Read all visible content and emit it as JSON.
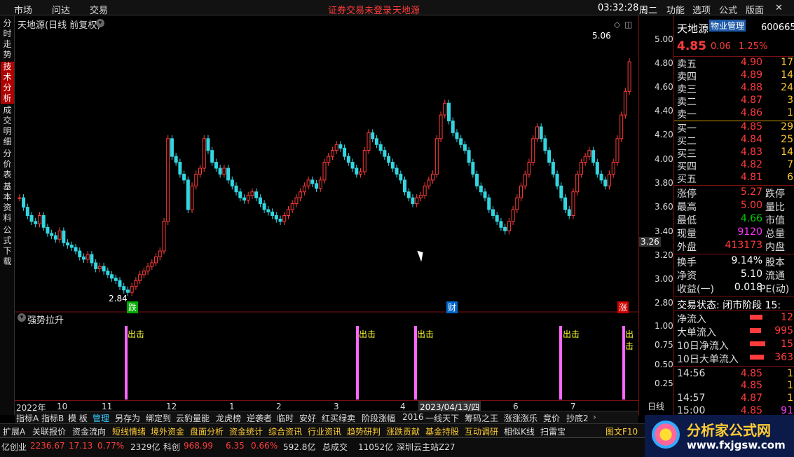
{
  "menubar": {
    "items": [
      "市场",
      "问达",
      "交易"
    ],
    "center_text": "证券交易未登录",
    "center_title": "天地源",
    "time": "03:32:28",
    "weekday": "周二",
    "right_items": [
      "功能",
      "选项",
      "公式",
      "版面"
    ]
  },
  "side_tabs": [
    "分时走势",
    "技术分析",
    "成交明细",
    "分价表",
    "基本资料",
    "公式下载"
  ],
  "chart": {
    "title": "天地源(日线 前复权)",
    "high_label": "5.06",
    "low_label": "2.84",
    "current_price_tag": "3.26",
    "markers": [
      "跌",
      "财",
      "涨"
    ],
    "y_ticks": [
      "5.00",
      "4.80",
      "4.60",
      "4.40",
      "4.20",
      "4.00",
      "3.80",
      "3.60",
      "3.40",
      "3.20",
      "3.00",
      "2.80"
    ],
    "indicator_title": "强势拉升",
    "indicator_y_ticks": [
      "1.00",
      "0.75",
      "0.50",
      "0.25"
    ],
    "signal_label": "出击",
    "x_axis_labels": [
      "2022年",
      "10",
      "11",
      "12",
      "1",
      "2",
      "3",
      "4",
      "2023/04/13/四",
      "6",
      "7"
    ],
    "period": "日线"
  },
  "quote": {
    "name": "天地源",
    "industry": "物业管理",
    "code": "600665",
    "price": "4.85",
    "change": "0.06",
    "change_pct": "1.25%",
    "asks": [
      {
        "label": "卖五",
        "price": "4.90",
        "vol": "17"
      },
      {
        "label": "卖四",
        "price": "4.89",
        "vol": "14"
      },
      {
        "label": "卖三",
        "price": "4.88",
        "vol": "24"
      },
      {
        "label": "卖二",
        "price": "4.87",
        "vol": "3"
      },
      {
        "label": "卖一",
        "price": "4.86",
        "vol": "1"
      }
    ],
    "bids": [
      {
        "label": "买一",
        "price": "4.85",
        "vol": "29"
      },
      {
        "label": "买二",
        "price": "4.84",
        "vol": "25"
      },
      {
        "label": "买三",
        "price": "4.83",
        "vol": "14"
      },
      {
        "label": "买四",
        "price": "4.82",
        "vol": "7"
      },
      {
        "label": "买五",
        "price": "4.81",
        "vol": "6"
      }
    ],
    "stats": [
      {
        "l": "涨停",
        "v": "5.27",
        "l2": "跌停"
      },
      {
        "l": "最高",
        "v": "5.00",
        "l2": "量比"
      },
      {
        "l": "最低",
        "v": "4.66",
        "l2": "市值"
      },
      {
        "l": "现量",
        "v": "9120",
        "l2": "总量"
      },
      {
        "l": "外盘",
        "v": "413173",
        "l2": "内盘"
      }
    ],
    "stats2": [
      {
        "l": "换手",
        "v": "9.14%",
        "l2": "股本"
      },
      {
        "l": "净资",
        "v": "5.10",
        "l2": "流通"
      },
      {
        "l": "收益(一)",
        "v": "0.018",
        "l2": "PE(动)"
      }
    ],
    "trade_status": "交易状态: 闭市阶段 15:",
    "flows": [
      {
        "l": "净流入",
        "v": "12"
      },
      {
        "l": "大单流入",
        "v": "995"
      },
      {
        "l": "10日净流入",
        "v": "15"
      },
      {
        "l": "10日大单流入",
        "v": "363"
      }
    ],
    "ticks": [
      {
        "t": "14:56",
        "p": "4.85",
        "v": "1"
      },
      {
        "t": "",
        "p": "4.85",
        "v": "1"
      },
      {
        "t": "14:57",
        "p": "4.87",
        "v": "1"
      },
      {
        "t": "15:00",
        "p": "4.85",
        "v": "91"
      }
    ]
  },
  "bottom_tabs": [
    "指标A",
    "指标B",
    "模 板",
    "管理",
    "另存为",
    "绑定到",
    "云豹量能",
    "龙虎榜",
    "逆袭者",
    "临时",
    "安好",
    "红买绿卖",
    "阶段涨幅",
    "2016",
    "一线天下",
    "筹码之王",
    "涨涨涨乐",
    "竞价",
    "抄底2"
  ],
  "module_bar": [
    "扩展A",
    "关联报价",
    "资金流向",
    "短线情绪",
    "境外资金",
    "盘面分析",
    "资金统计",
    "综合资讯",
    "行业资讯",
    "趋势研判",
    "涨跌贡献",
    "基金持股",
    "互动调研",
    "相似K线",
    "扫雷宝",
    "图文F10"
  ],
  "status_bar": {
    "prefix": "亿",
    "cy_label": "创业",
    "cy_val": "2236.67",
    "cy_chg": "17.13",
    "cy_pct": "0.77%",
    "cy_amt": "2329亿",
    "kc_label": "科创",
    "kc_val": "968.99",
    "kc_chg": "6.35",
    "kc_pct": "0.66%",
    "kc_amt": "592.8亿",
    "total_label": "总成交",
    "total_val": "11052亿",
    "server": "深圳云主站Z27"
  },
  "logo": {
    "title": "分析家公式网",
    "url": "www.fxjgsw.com"
  },
  "colors": {
    "up": "#ff3b3b",
    "down": "#33d6e0",
    "indicator": "#ff66ff",
    "accent": "#b00000"
  },
  "chart_data": {
    "type": "candlestick",
    "ylim": [
      2.8,
      5.1
    ],
    "close": [
      3.7,
      3.62,
      3.55,
      3.5,
      3.48,
      3.55,
      3.45,
      3.4,
      3.38,
      3.35,
      3.42,
      3.32,
      3.3,
      3.28,
      3.25,
      3.2,
      3.18,
      3.22,
      3.15,
      3.1,
      3.12,
      3.08,
      3.05,
      3.02,
      3.0,
      2.95,
      2.92,
      2.9,
      2.95,
      3.0,
      3.05,
      3.08,
      3.12,
      3.15,
      3.2,
      3.25,
      3.5,
      4.2,
      4.05,
      4.0,
      3.9,
      3.85,
      3.6,
      3.8,
      3.9,
      3.95,
      4.2,
      4.1,
      4.0,
      3.95,
      3.9,
      3.95,
      3.85,
      3.8,
      3.75,
      3.7,
      3.68,
      3.72,
      3.75,
      3.7,
      3.65,
      3.6,
      3.58,
      3.55,
      3.52,
      3.5,
      3.55,
      3.6,
      3.65,
      3.7,
      3.75,
      3.8,
      3.85,
      3.82,
      3.78,
      3.85,
      4.0,
      4.05,
      4.1,
      4.15,
      4.12,
      4.05,
      4.0,
      3.95,
      3.9,
      3.92,
      4.1,
      4.25,
      4.2,
      4.15,
      4.1,
      4.05,
      4.0,
      3.95,
      3.9,
      3.85,
      3.75,
      3.7,
      3.65,
      3.7,
      3.72,
      3.8,
      3.85,
      3.9,
      4.2,
      4.4,
      4.5,
      4.35,
      4.25,
      4.2,
      4.15,
      4.1,
      4.0,
      3.9,
      3.8,
      3.75,
      3.7,
      3.6,
      3.55,
      3.5,
      3.45,
      3.42,
      3.5,
      3.6,
      3.7,
      3.8,
      3.9,
      4.0,
      4.2,
      4.3,
      4.2,
      4.1,
      4.0,
      3.9,
      3.8,
      3.7,
      3.6,
      3.55,
      3.75,
      3.9,
      4.0,
      4.05,
      4.1,
      4.0,
      3.9,
      3.85,
      3.8,
      3.9,
      4.0,
      4.2,
      4.4,
      4.6,
      4.85
    ]
  }
}
